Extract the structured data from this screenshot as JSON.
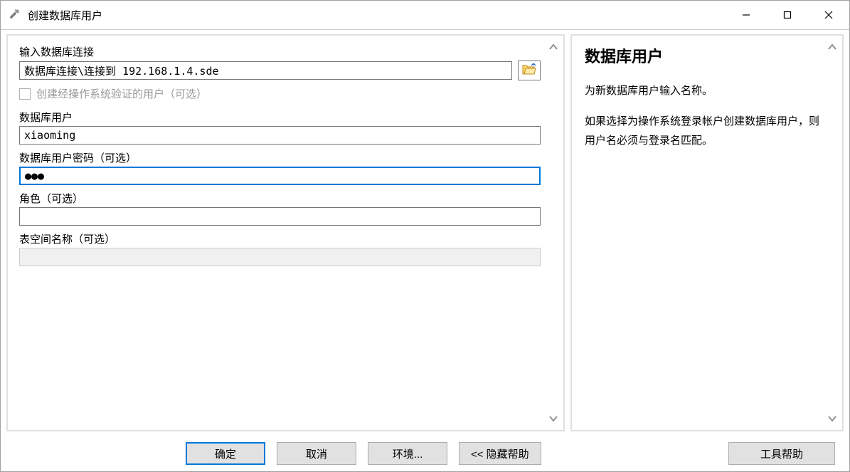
{
  "window": {
    "title": "创建数据库用户"
  },
  "form": {
    "connection_label": "输入数据库连接",
    "connection_value": "数据库连接\\连接到 192.168.1.4.sde",
    "os_auth_label": "创建经操作系统验证的用户（可选）",
    "os_auth_checked": false,
    "user_label": "数据库用户",
    "user_value": "xiaoming",
    "password_label": "数据库用户密码（可选）",
    "password_value": "●●●",
    "role_label": "角色（可选）",
    "role_value": "",
    "tablespace_label": "表空间名称（可选）",
    "tablespace_value": ""
  },
  "help": {
    "title": "数据库用户",
    "para1": "为新数据库用户输入名称。",
    "para2": "如果选择为操作系统登录帐户创建数据库用户，则用户名必须与登录名匹配。"
  },
  "buttons": {
    "ok": "确定",
    "cancel": "取消",
    "environments": "环境...",
    "hide_help": "<< 隐藏帮助",
    "tool_help": "工具帮助"
  }
}
